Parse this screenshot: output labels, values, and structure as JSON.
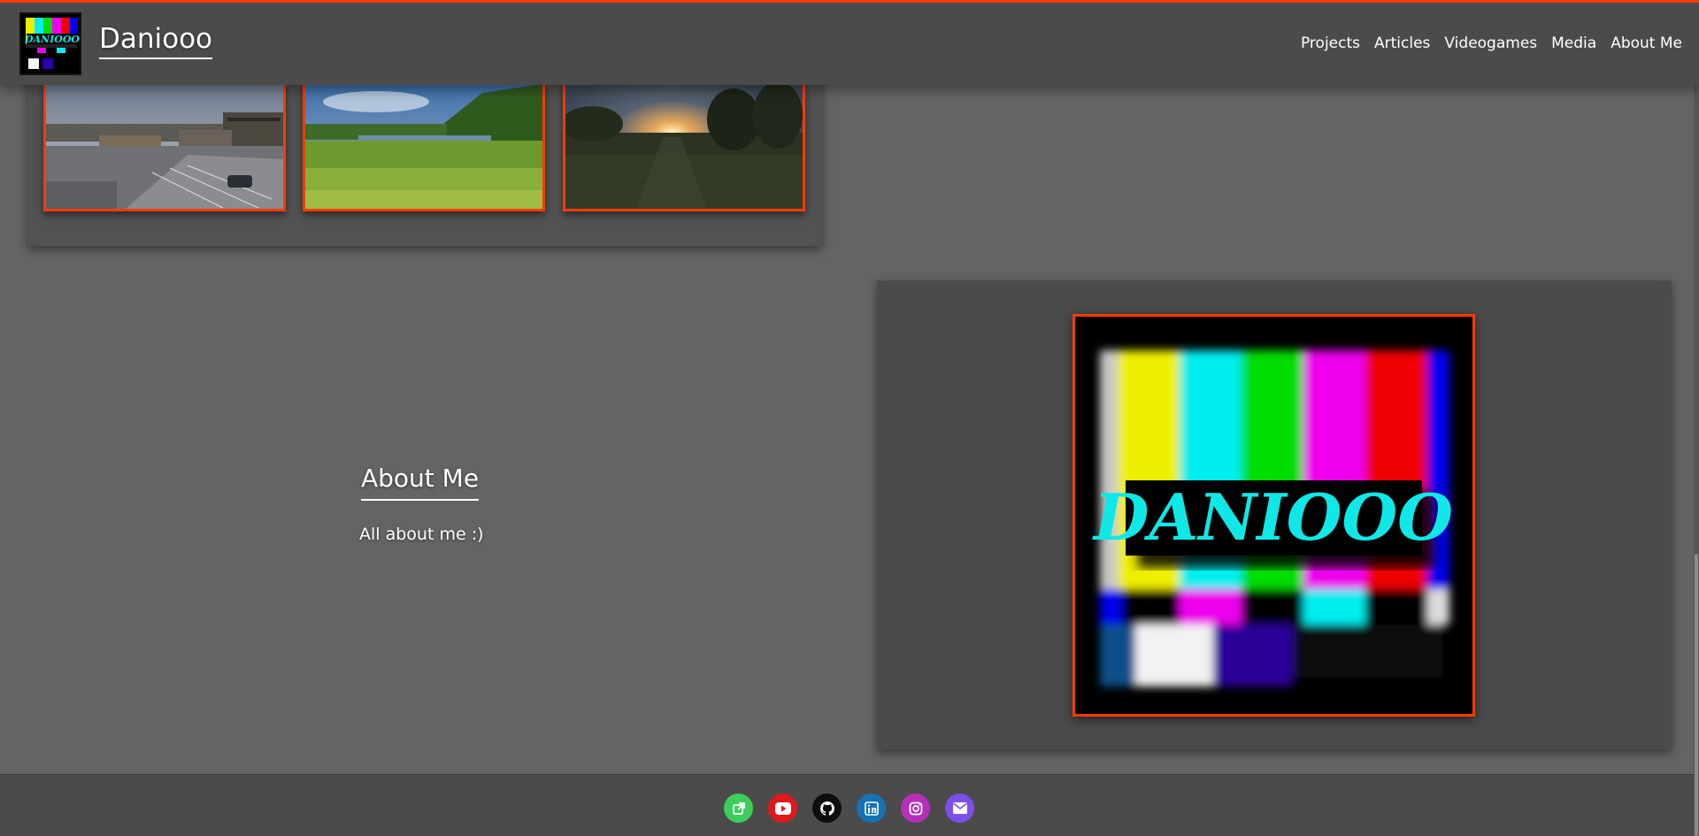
{
  "header": {
    "site_title": "Daniooo",
    "logo_text": "DANIOOO",
    "nav": [
      {
        "label": "Projects"
      },
      {
        "label": "Articles"
      },
      {
        "label": "Videogames"
      },
      {
        "label": "Media"
      },
      {
        "label": "About Me"
      }
    ]
  },
  "gallery": {
    "photos": [
      {
        "icon": "town-parking-lot-photo"
      },
      {
        "icon": "lake-meadow-photo"
      },
      {
        "icon": "sunset-forest-photo"
      }
    ]
  },
  "about": {
    "title": "About Me",
    "subtitle": "All about me :)"
  },
  "logo_card": {
    "logo_text": "DANIOOO"
  },
  "footer": {
    "social": [
      {
        "icon": "external-link-icon",
        "color": "#3ccd5b"
      },
      {
        "icon": "youtube-icon",
        "color": "#e0191b"
      },
      {
        "icon": "github-icon",
        "color": "#0d0d0d"
      },
      {
        "icon": "linkedin-icon",
        "color": "#1572b5"
      },
      {
        "icon": "instagram-icon",
        "color": "#b62fb8"
      },
      {
        "icon": "email-icon",
        "color": "#7e4ee8"
      }
    ]
  },
  "colors": {
    "accent": "#ff3a00",
    "page_bg": "#646464",
    "panel_bg": "#4b4b4b"
  }
}
